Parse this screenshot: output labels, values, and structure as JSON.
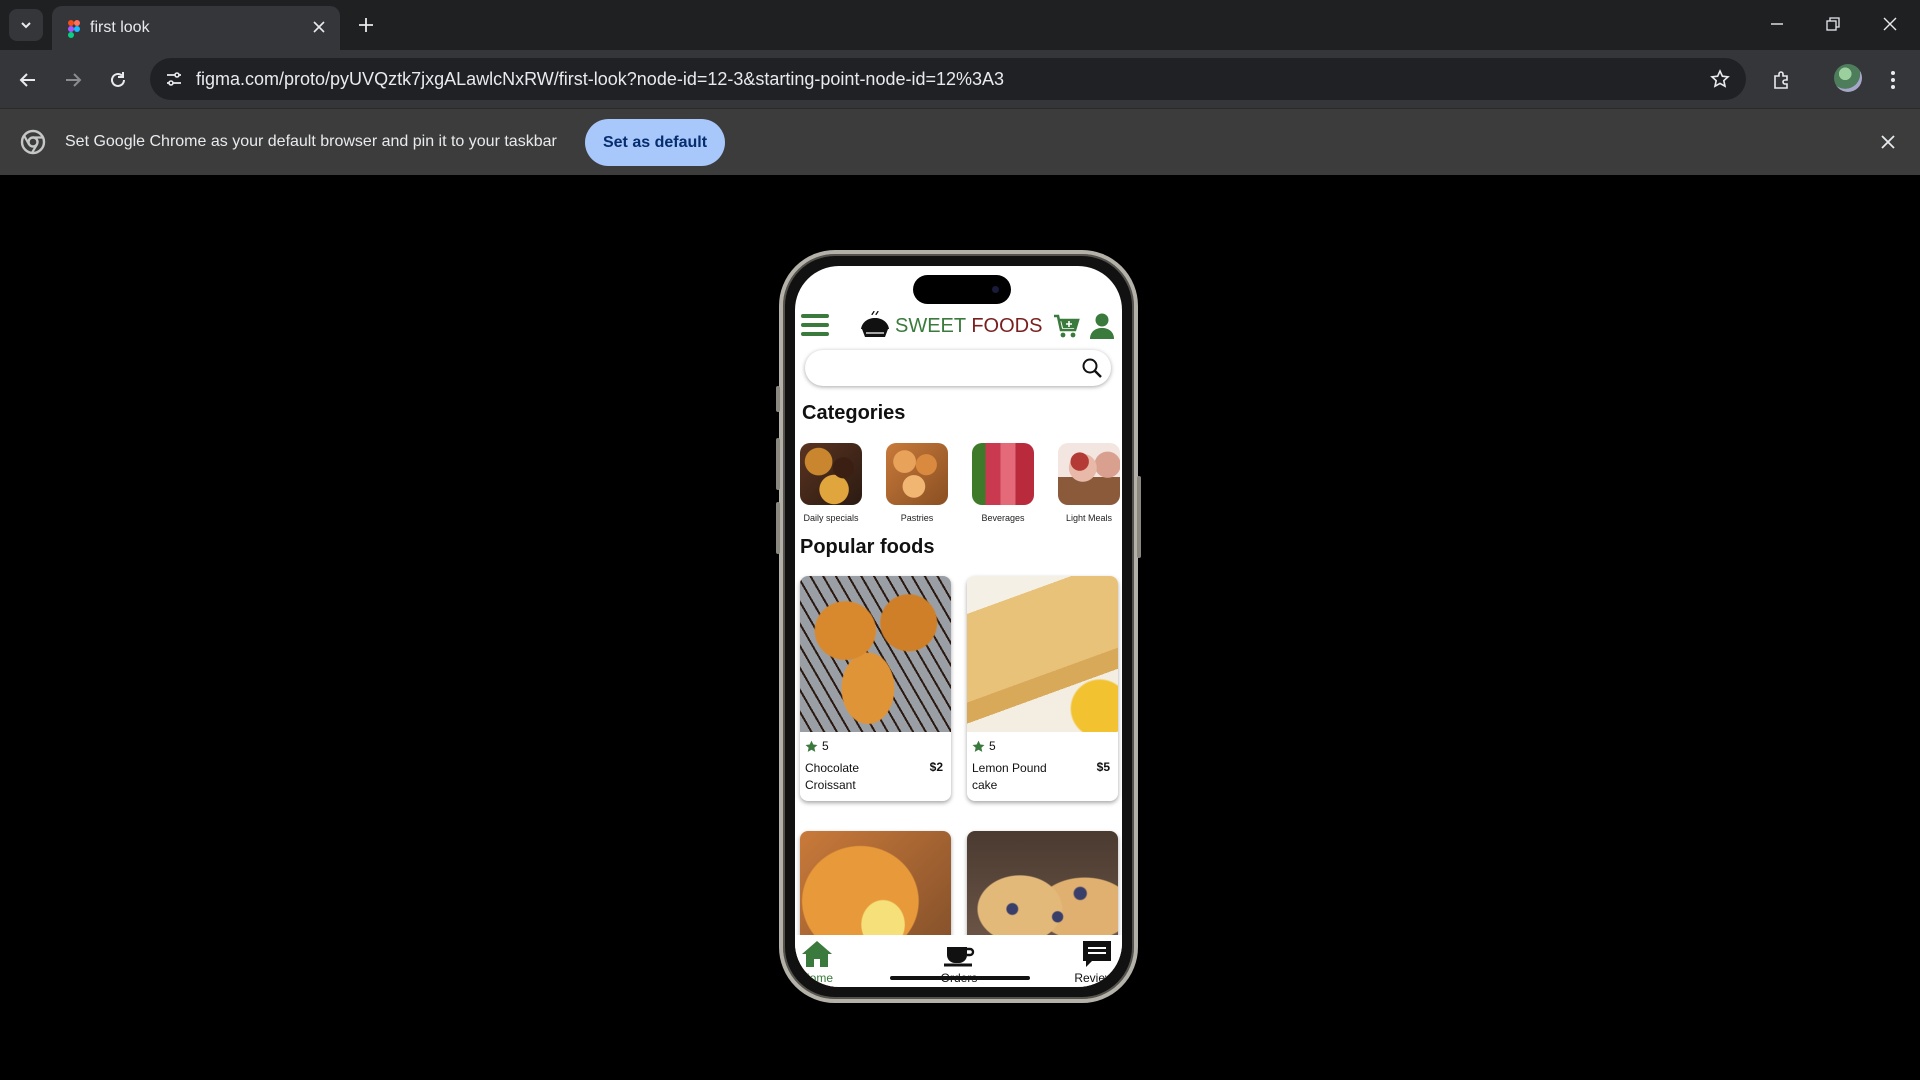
{
  "browser": {
    "tab_title": "first look",
    "url": "figma.com/proto/pyUVQztk7jxgALawlcNxRW/first-look?node-id=12-3&starting-point-node-id=12%3A3",
    "infobar_text": "Set Google Chrome as your default browser and pin it to your taskbar",
    "infobar_button": "Set as default"
  },
  "app": {
    "brand_part1": "SWEET ",
    "brand_part2": "FOODS",
    "brand_colors": {
      "green": "#3a7a3c",
      "maroon": "#7a1f1f"
    },
    "search_placeholder": "",
    "categories_title": "Categories",
    "categories": [
      {
        "label": "Daily specials"
      },
      {
        "label": "Pastries"
      },
      {
        "label": "Beverages"
      },
      {
        "label": "Light Meals"
      }
    ],
    "popular_title": "Popular foods",
    "foods": [
      {
        "rating": "5",
        "name": "Chocolate Croissant",
        "price": "$2"
      },
      {
        "rating": "5",
        "name": "Lemon Pound cake",
        "price": "$5"
      },
      {
        "rating": "",
        "name": "",
        "price": ""
      },
      {
        "rating": "",
        "name": "",
        "price": ""
      }
    ],
    "nav": [
      {
        "label": "Home",
        "active": true
      },
      {
        "label": "Orders",
        "active": false
      },
      {
        "label": "Reviews",
        "active": false
      }
    ]
  }
}
